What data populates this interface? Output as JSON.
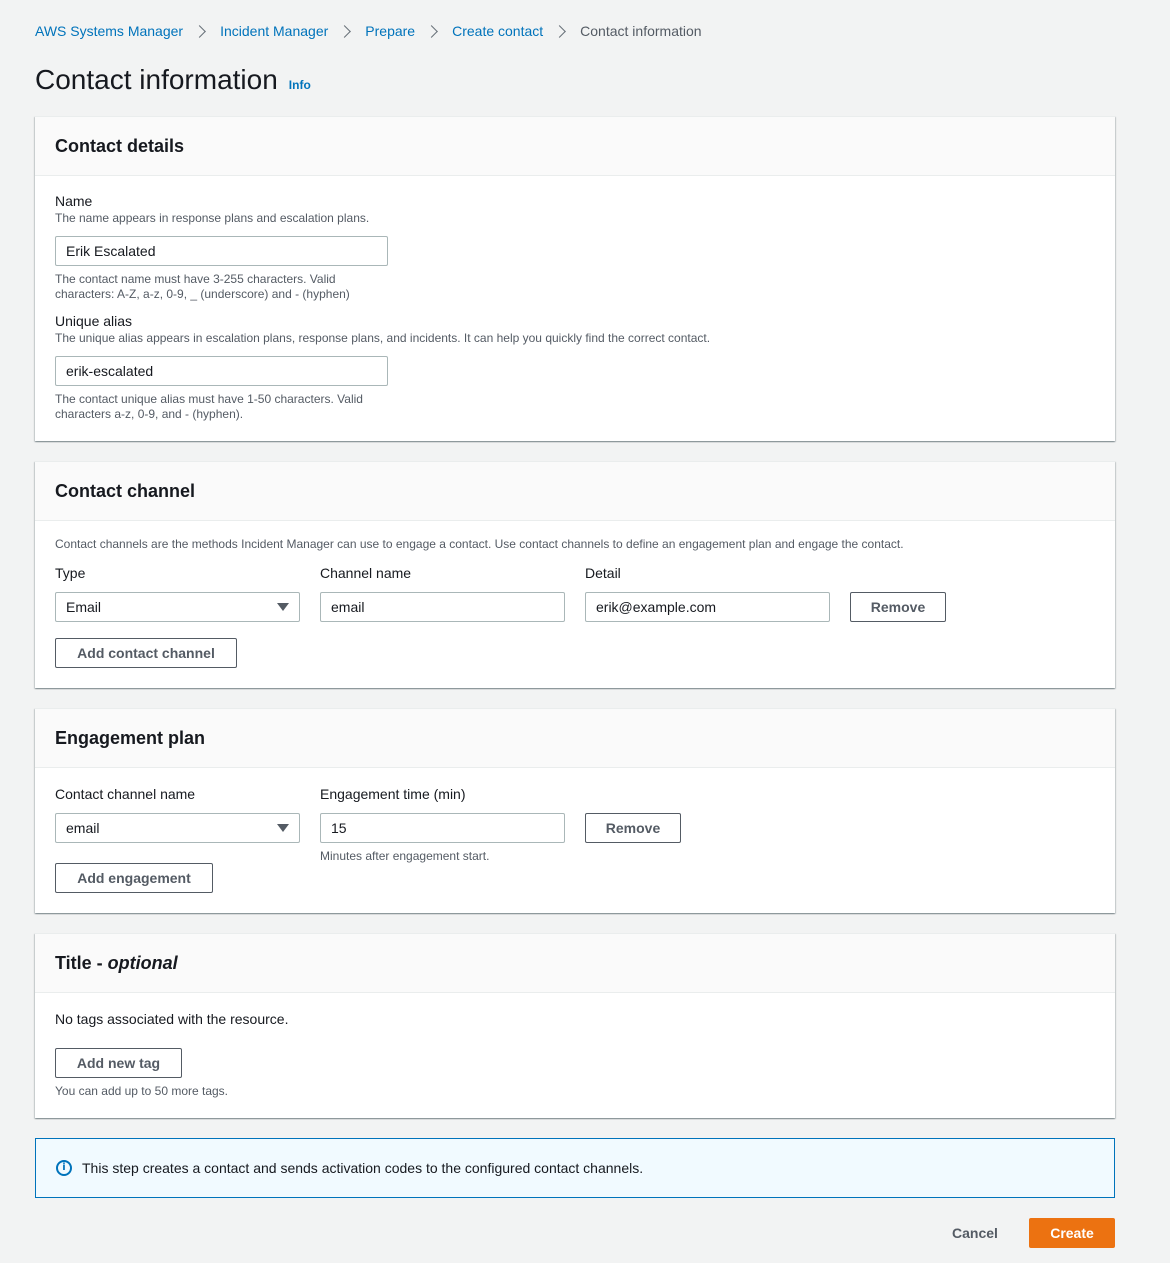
{
  "breadcrumb": {
    "items": [
      "AWS Systems Manager",
      "Incident Manager",
      "Prepare",
      "Create contact"
    ],
    "current": "Contact information"
  },
  "page": {
    "title": "Contact information",
    "info_link": "Info"
  },
  "contact_details": {
    "header": "Contact details",
    "name_label": "Name",
    "name_desc": "The name appears in response plans and escalation plans.",
    "name_value": "Erik Escalated",
    "name_constraint_1": "The contact name must have 3-255 characters. Valid",
    "name_constraint_2": "characters: A-Z, a-z, 0-9, _ (underscore) and - (hyphen)",
    "alias_label": "Unique alias",
    "alias_desc": "The unique alias appears in escalation plans, response plans, and incidents. It can help you quickly find the correct contact.",
    "alias_value": "erik-escalated",
    "alias_constraint_1": "The contact unique alias must have 1-50 characters. Valid",
    "alias_constraint_2": "characters a-z, 0-9, and - (hyphen)."
  },
  "contact_channel": {
    "header": "Contact channel",
    "description": "Contact channels are the methods Incident Manager can use to engage a contact. Use contact channels to define an engagement plan and engage the contact.",
    "type_label": "Type",
    "channel_name_label": "Channel name",
    "detail_label": "Detail",
    "type_value": "Email",
    "channel_name_value": "email",
    "detail_value": "erik@example.com",
    "remove_label": "Remove",
    "add_label": "Add contact channel"
  },
  "engagement_plan": {
    "header": "Engagement plan",
    "channel_name_label": "Contact channel name",
    "time_label": "Engagement time (min)",
    "channel_value": "email",
    "time_value": "15",
    "time_hint": "Minutes after engagement start.",
    "remove_label": "Remove",
    "add_label": "Add engagement"
  },
  "tags": {
    "header": "Title -",
    "header_optional": "optional",
    "empty_text": "No tags associated with the resource.",
    "add_label": "Add new tag",
    "limit_text": "You can add up to 50 more tags."
  },
  "alert": {
    "icon": "info-icon",
    "text": "This step creates a contact and sends activation codes to the configured contact channels."
  },
  "footer": {
    "cancel_label": "Cancel",
    "create_label": "Create"
  },
  "colors": {
    "link": "#0073bb",
    "primary_button": "#ec7211",
    "background": "#f2f3f3"
  }
}
